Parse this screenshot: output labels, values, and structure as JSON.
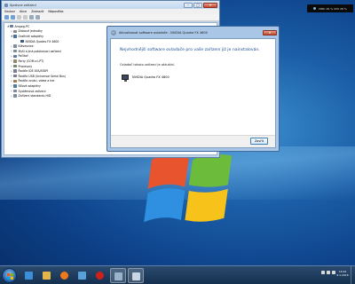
{
  "device_manager": {
    "title": "Správce zařízení",
    "menu": [
      "Soubor",
      "Akce",
      "Zobrazit",
      "Nápověda"
    ],
    "tree": [
      {
        "label": "Ampeg-PC",
        "level": 0,
        "expander": "◢",
        "icon_color": "#6a7f9b"
      },
      {
        "label": "Diskové jednotky",
        "level": 1,
        "expander": "▷",
        "icon_color": "#8a8a8a"
      },
      {
        "label": "Grafické adaptéry",
        "level": 1,
        "expander": "◢",
        "icon_color": "#4b6f9c"
      },
      {
        "label": "NVIDIA Quadro FX 4600",
        "level": 2,
        "expander": "",
        "icon_color": "#3b5a84"
      },
      {
        "label": "Klávesnice",
        "level": 1,
        "expander": "▷",
        "icon_color": "#7f8c9a"
      },
      {
        "label": "Myši a jiná polohovací zařízení",
        "level": 1,
        "expander": "▷",
        "icon_color": "#7f8c9a"
      },
      {
        "label": "Počítač",
        "level": 1,
        "expander": "▷",
        "icon_color": "#5d7aa3"
      },
      {
        "label": "Porty (COM a LPT)",
        "level": 1,
        "expander": "▷",
        "icon_color": "#8b8b6a"
      },
      {
        "label": "Procesory",
        "level": 1,
        "expander": "▷",
        "icon_color": "#6f8a6f"
      },
      {
        "label": "Řadiče IDE ATA/ATAPI",
        "level": 1,
        "expander": "▷",
        "icon_color": "#7a7a9a"
      },
      {
        "label": "Řadiče USB (Universal Serial Bus)",
        "level": 1,
        "expander": "▷",
        "icon_color": "#7a7a9a"
      },
      {
        "label": "Řadiče zvuku, videa a her",
        "level": 1,
        "expander": "▷",
        "icon_color": "#a07d4b"
      },
      {
        "label": "Síťové adaptéry",
        "level": 1,
        "expander": "▷",
        "icon_color": "#4b7da0"
      },
      {
        "label": "Systémová zařízení",
        "level": 1,
        "expander": "▷",
        "icon_color": "#7a8a9a"
      },
      {
        "label": "Zařízení standardu HID",
        "level": 1,
        "expander": "▷",
        "icon_color": "#7f8c9a"
      }
    ]
  },
  "driver_dialog": {
    "title": "Aktualizovat software ovladače - NVIDIA Quadro FX 4600",
    "heading": "Nejvhodnější software ovladače pro vaše zařízení již je nainstalován.",
    "status": "Ovladač tohoto zařízení je aktuální.",
    "device_name": "NVIDIA Quadro FX 4600",
    "close_label": "Zavřít"
  },
  "gadget": {
    "text": "MMC 26 %  CPU 28 %"
  },
  "taskbar": {
    "clock_time": "14:02",
    "clock_date": "9.1.2016",
    "items": [
      {
        "icon": "ie-icon",
        "color": "#3b8fd9"
      },
      {
        "icon": "explorer-icon",
        "color": "#e3b64a"
      },
      {
        "icon": "media-player-icon",
        "color": "#f07a1a"
      },
      {
        "icon": "store-icon",
        "color": "#5aa0d8"
      },
      {
        "icon": "opera-icon",
        "color": "#d0201b"
      },
      {
        "icon": "device-manager-icon",
        "color": "#9ab2cc"
      },
      {
        "icon": "mail-icon",
        "color": "#c8d6e4"
      }
    ]
  }
}
